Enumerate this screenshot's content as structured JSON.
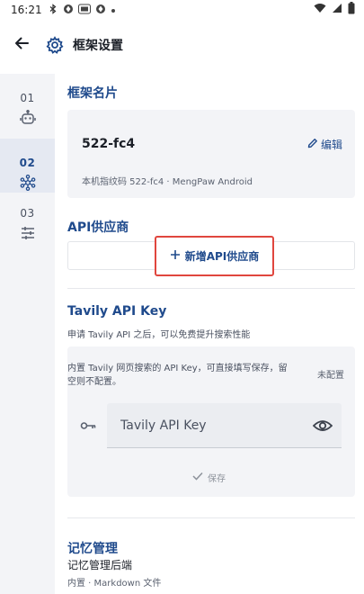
{
  "status_bar": {
    "time": "16:21",
    "icons": [
      "bluetooth-icon",
      "app-notification-icon",
      "app-badge-icon",
      "app-notification-icon",
      "more-dot-icon"
    ],
    "right_icons": [
      "wifi-icon",
      "cellular-signal-icon",
      "battery-icon"
    ]
  },
  "app_bar": {
    "title": "框架设置",
    "back_icon": "arrow-left-icon",
    "title_icon": "gear-icon"
  },
  "rail": {
    "items": [
      {
        "num": "01",
        "icon": "robot-icon",
        "active": false
      },
      {
        "num": "02",
        "icon": "network-hub-icon",
        "active": true
      },
      {
        "num": "03",
        "icon": "sliders-icon",
        "active": false
      }
    ]
  },
  "frame_section": {
    "title": "框架名片",
    "name": "522-fc4",
    "edit_label": "编辑",
    "fingerprint": "本机指纹码 522-fc4 · MengPaw Android"
  },
  "api_section": {
    "title": "API供应商",
    "add_label": "新增API供应商"
  },
  "tavily_section": {
    "title": "Tavily API Key",
    "subtitle": "申请 Tavily API 之后，可以免费提升搜索性能",
    "description": "内置 Tavily 网页搜索的 API Key，可直接填写保存，留空则不配置。",
    "state": "未配置",
    "placeholder": "Tavily API Key",
    "save_label": "保存"
  },
  "memory_section": {
    "title": "记忆管理",
    "label": "记忆管理后端",
    "value": "内置 · Markdown 文件"
  },
  "colors": {
    "accent": "#1f4a8c",
    "highlight": "#e0463e",
    "rail_bg": "#f3f4f7",
    "card_bg": "#f3f4f7"
  }
}
